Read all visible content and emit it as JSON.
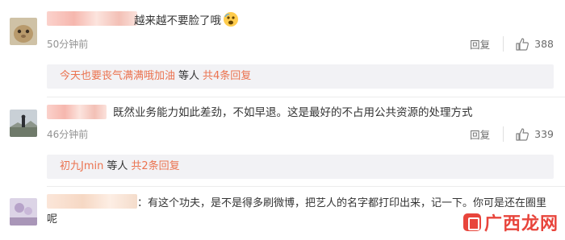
{
  "comments": [
    {
      "text": "越来越不要脸了哦",
      "emoji": "fearful-face-emoji",
      "time": "50分钟前",
      "reply_label": "回复",
      "likes": "388",
      "thread": {
        "who": "今天也要丧气满满哦加油",
        "etc": "等人",
        "count": "共4条回复"
      }
    },
    {
      "text": "既然业务能力如此差劲，不如早退。这是最好的不占用公共资源的处理方式",
      "time": "46分钟前",
      "reply_label": "回复",
      "likes": "339",
      "thread": {
        "who": "初九Jmin",
        "etc": "等人",
        "count": "共2条回复"
      }
    },
    {
      "text": "：有这个功夫，是不是得多刷微博，把艺人的名字都打印出来，记一下。你可是还在圈里呢"
    }
  ],
  "watermark": {
    "text": "广西龙网"
  },
  "colors": {
    "link": "#eb7350",
    "time": "#939393",
    "reply_bg": "#f2f2f5",
    "watermark": "#e8453c"
  }
}
